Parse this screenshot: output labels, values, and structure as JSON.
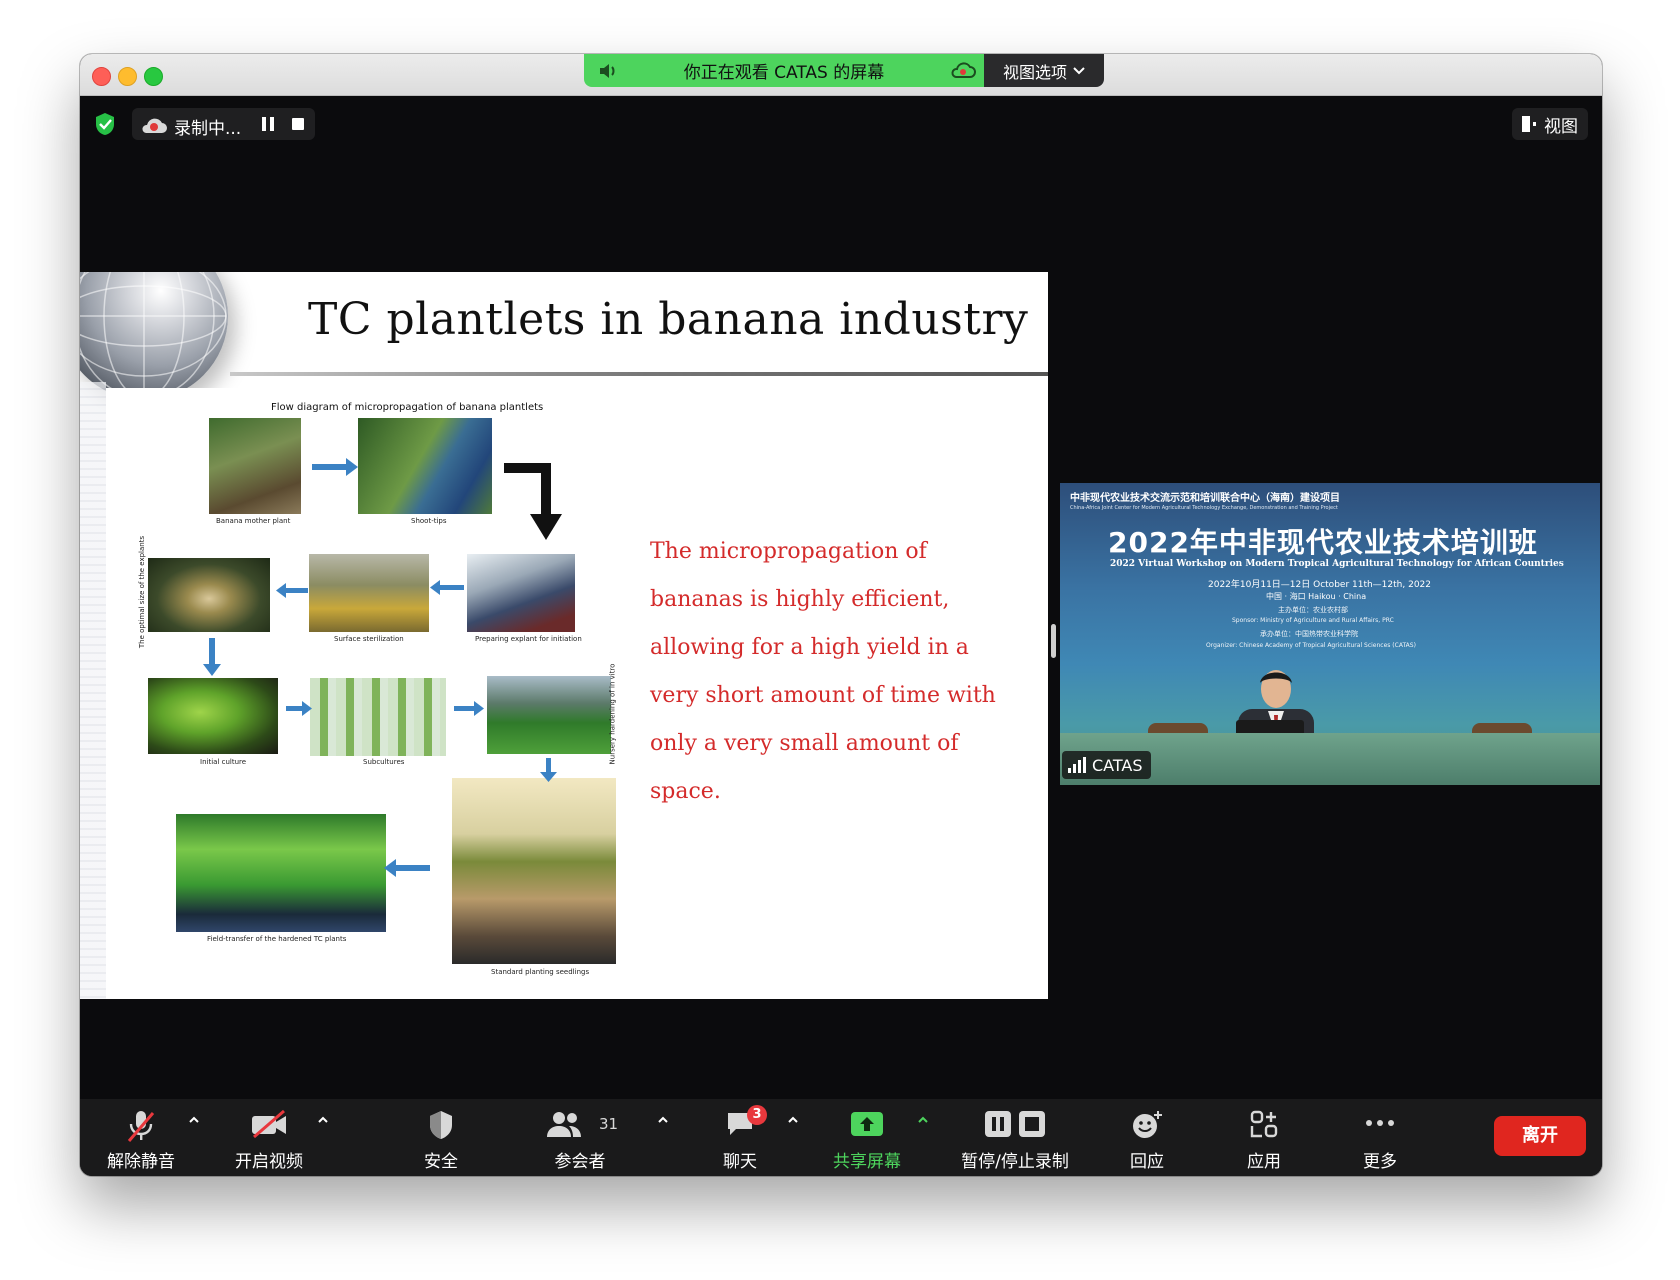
{
  "share_banner": {
    "text": "你正在观看 CATAS 的屏幕",
    "view_options_label": "视图选项"
  },
  "recording": {
    "label": "录制中..."
  },
  "view_button": {
    "label": "视图"
  },
  "slide": {
    "title": "TC plantlets in banana industry",
    "diagram_title": "Flow diagram of micropropagation of  banana plantlets",
    "captions": {
      "mother": "Banana mother plant",
      "shoot": "Shoot-tips",
      "explant": "Preparing explant for initiation",
      "sterilization": "Surface sterilization",
      "optimal": "The optimal size of the explants",
      "initial": "Initial culture",
      "subcultures": "Subcultures",
      "nursery": "Nursery hardening of in vitro",
      "seedlings": "Standard planting seedlings",
      "field": "Field-transfer of the hardened TC plants"
    },
    "text_lines": [
      "The micropropagation of",
      "bananas is highly efficient,",
      "allowing for a high yield in a",
      "very short amount of time with",
      "only a very small amount of",
      "space."
    ],
    "text_color": "#d42b2b"
  },
  "video": {
    "participant_name": "CATAS",
    "banner_top": "中非现代农业技术交流示范和培训联合中心（海南）建设项目",
    "banner_top_en": "China-Africa Joint Center for Modern Agricultural Technology Exchange, Demonstration and Training Project",
    "banner_title": "2022年中非现代农业技术培训班",
    "banner_subtitle": "2022 Virtual Workshop on Modern Tropical Agricultural Technology for African Countries",
    "banner_date": "2022年10月11日—12日    October 11th—12th, 2022",
    "banner_location": "中国 · 海口    Haikou · China",
    "banner_host": "主办单位：农业农村部",
    "banner_sponsor": "Sponsor: Ministry of Agriculture and Rural Affairs, PRC",
    "banner_organizer_cn": "承办单位：中国热带农业科学院",
    "banner_organizer": "Organizer: Chinese Academy of Tropical Agricultural Sciences (CATAS)"
  },
  "toolbar": {
    "unmute": "解除静音",
    "start_video": "开启视频",
    "security": "安全",
    "participants": "参会者",
    "participants_count": "31",
    "chat": "聊天",
    "chat_badge": "3",
    "share_screen": "共享屏幕",
    "pause_stop_recording": "暂停/停止录制",
    "reactions": "回应",
    "apps": "应用",
    "more": "更多",
    "leave": "离开"
  },
  "colors": {
    "share_green": "#4dd45d",
    "leave_red": "#e0261f",
    "slide_text_red": "#d42b2b"
  }
}
